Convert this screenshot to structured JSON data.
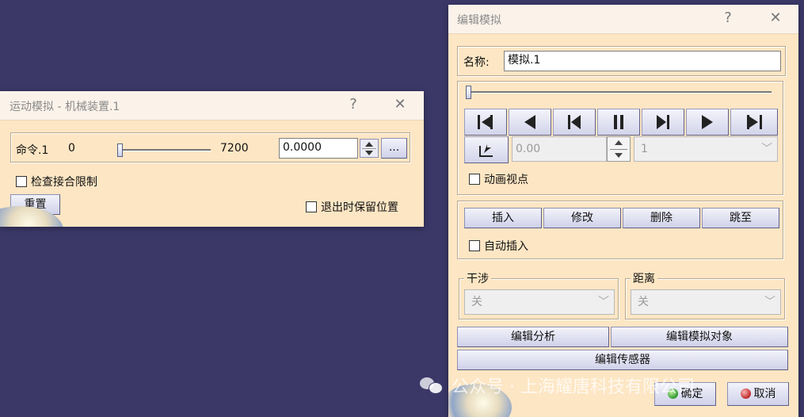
{
  "motion_dialog": {
    "title": "运动模拟 - 机械装置.1",
    "help": "?",
    "close": "✕",
    "command_label": "命令.1",
    "range_min": "0",
    "range_max": "7200",
    "slider_fraction": 0.0,
    "value": "0.0000",
    "more_label": "...",
    "check_limits_label": "检查接合限制",
    "reset_label": "重置",
    "keep_position_label": "退出时保留位置"
  },
  "edit_dialog": {
    "title": "编辑模拟",
    "help": "?",
    "close": "✕",
    "name_label": "名称:",
    "name_value": "模拟.1",
    "timeline_fraction": 0.0,
    "step_value": "0.00",
    "step_count": "1",
    "animate_viewpoint_label": "动画视点",
    "insert_label": "插入",
    "modify_label": "修改",
    "delete_label": "删除",
    "jump_label": "跳至",
    "auto_insert_label": "自动插入",
    "interference_label": "干涉",
    "interference_value": "关",
    "distance_label": "距离",
    "distance_value": "关",
    "edit_analysis_label": "编辑分析",
    "edit_sim_objects_label": "编辑模拟对象",
    "edit_sensors_label": "编辑传感器",
    "ok_label": "确定",
    "cancel_label": "取消"
  },
  "watermark": {
    "text": "公众号 · 上海耀唐科技有限公司"
  },
  "colors": {
    "desktop": "#3b3868",
    "dialog_bg": "#fde6c4",
    "ok_icon": "#2e9a2e",
    "cancel_icon": "#c0282a"
  }
}
